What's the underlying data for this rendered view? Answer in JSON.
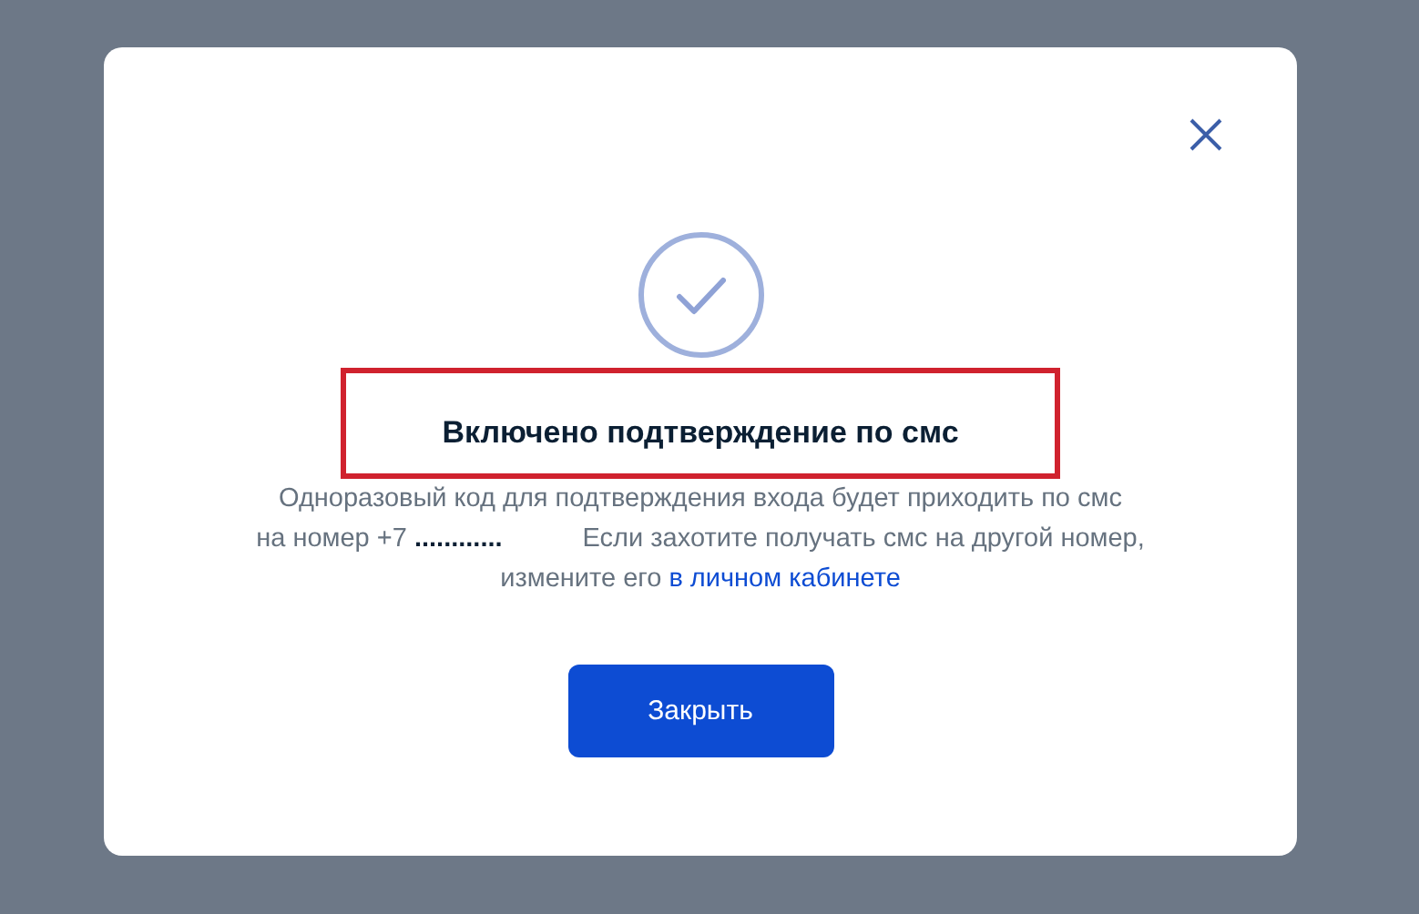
{
  "dialog": {
    "title": "Включено подтверждение по смс",
    "title_highlighted": true,
    "message": {
      "line_1": "Одноразовый код для подтверждения входа будет приходить по смс",
      "line_2a": "на номер +7 **............**",
      "line_2b": "Если захотите получать смс на другой номер,",
      "line_3": "измените его",
      "link": "в личном кабинете"
    },
    "button": "Закрыть"
  }
}
